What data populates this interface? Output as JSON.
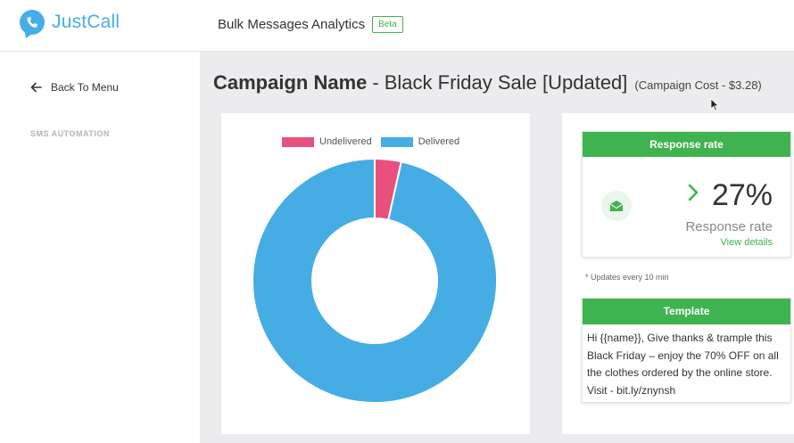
{
  "header": {
    "logo_text": "JustCall",
    "title": "Bulk Messages Analytics",
    "badge": "Beta"
  },
  "sidebar": {
    "back_label": "Back To Menu",
    "section_label": "SMS AUTOMATION"
  },
  "campaign": {
    "label": "Campaign Name",
    "separator": "-",
    "name": "Black Friday Sale [Updated]",
    "cost": "(Campaign Cost - $3.28)"
  },
  "chart_data": {
    "type": "pie",
    "donut": true,
    "categories": [
      "Undelivered",
      "Delivered"
    ],
    "values": [
      3.5,
      96.5
    ],
    "colors": [
      "#e8507d",
      "#45ade3"
    ],
    "legend": "top"
  },
  "response": {
    "header": "Response rate",
    "value": "27%",
    "label": "Response rate",
    "link": "View details",
    "note": "* Updates every 10 min"
  },
  "template": {
    "header": "Template",
    "text": "Hi {{name}}, Give thanks & trample this Black Friday – enjoy the 70% OFF on all the clothes ordered by the online store. Visit - bit.ly/znynsh"
  },
  "icons": {
    "logo": "phone-bubble-icon",
    "back": "arrow-left-icon",
    "response": "envelope-open-icon",
    "trend": "chevron-right-icon"
  }
}
